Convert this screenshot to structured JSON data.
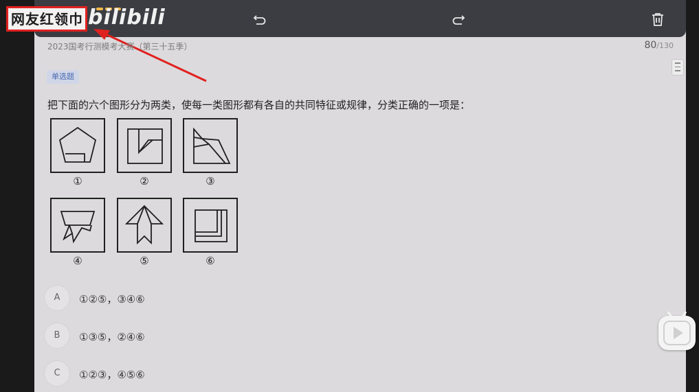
{
  "watermark": {
    "text": "网友红领巾"
  },
  "logo": {
    "text": "bilibili"
  },
  "toolbar": {
    "undo_icon": "undo-icon",
    "redo_icon": "redo-icon",
    "delete_icon": "trash-icon"
  },
  "exam": {
    "title": "2023国考行测模考大赛（第三十五季）",
    "current": "80",
    "total": "/130"
  },
  "question": {
    "type_tag": "单选题",
    "text": "把下面的六个图形分为两类，使每一类图形都有各自的共同特征或规律，分类正确的一项是：",
    "figures": [
      {
        "label": "①"
      },
      {
        "label": "②"
      },
      {
        "label": "③"
      },
      {
        "label": "④"
      },
      {
        "label": "⑤"
      },
      {
        "label": "⑥"
      }
    ],
    "options": [
      {
        "letter": "A",
        "text": "①②⑤，③④⑥"
      },
      {
        "letter": "B",
        "text": "①③⑤，②④⑥"
      },
      {
        "letter": "C",
        "text": "①②③，④⑤⑥"
      }
    ]
  },
  "colors": {
    "annotation_red": "#e0211f",
    "tag_blue": "#4b6ab0",
    "page_bg": "#dcdadc"
  }
}
